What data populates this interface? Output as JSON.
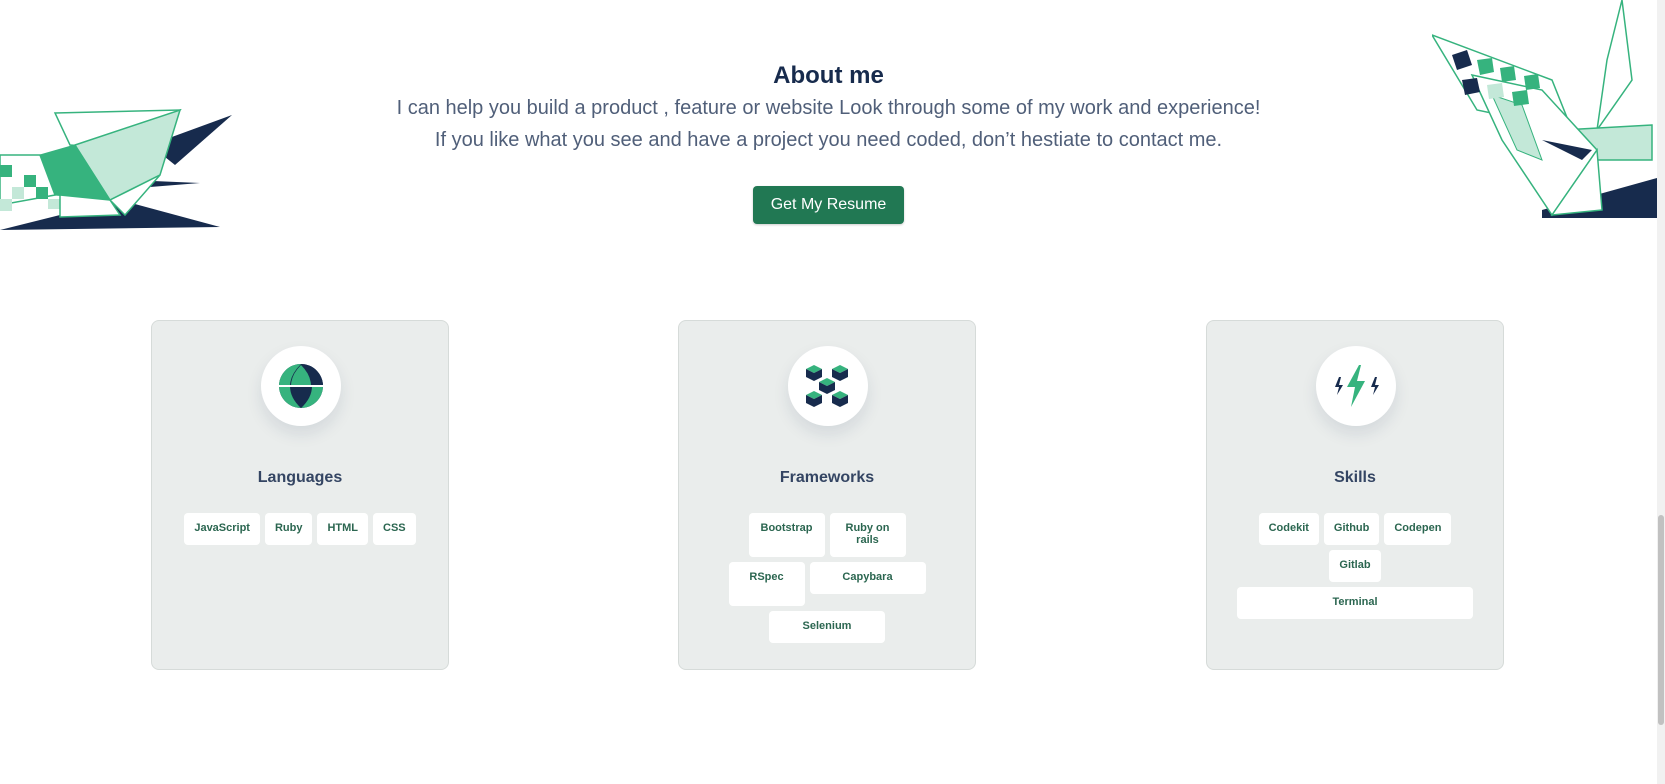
{
  "about": {
    "heading": "About me",
    "line1": "I can help you build a product , feature or website Look through some of my work and experience!",
    "line2": "If you like what you see and have a project you need coded, don’t hestiate to contact me.",
    "resume_button": "Get My Resume"
  },
  "cards": [
    {
      "title": "Languages",
      "icon": "globe-icon",
      "tags": [
        "JavaScript",
        "Ruby",
        "HTML",
        "CSS"
      ]
    },
    {
      "title": "Frameworks",
      "icon": "cubes-icon",
      "tags": [
        "Bootstrap",
        "Ruby on rails",
        "RSpec",
        "Capybara",
        "Selenium"
      ]
    },
    {
      "title": "Skills",
      "icon": "lightning-icon",
      "tags": [
        "Codekit",
        "Github",
        "Codepen",
        "Gitlab",
        "Terminal"
      ]
    }
  ],
  "colors": {
    "navy": "#172b4d",
    "green": "#36b37e",
    "light_green": "#c3e8d8",
    "button": "#217853",
    "card_bg": "#eaedec",
    "tag_text": "#2b6650"
  }
}
